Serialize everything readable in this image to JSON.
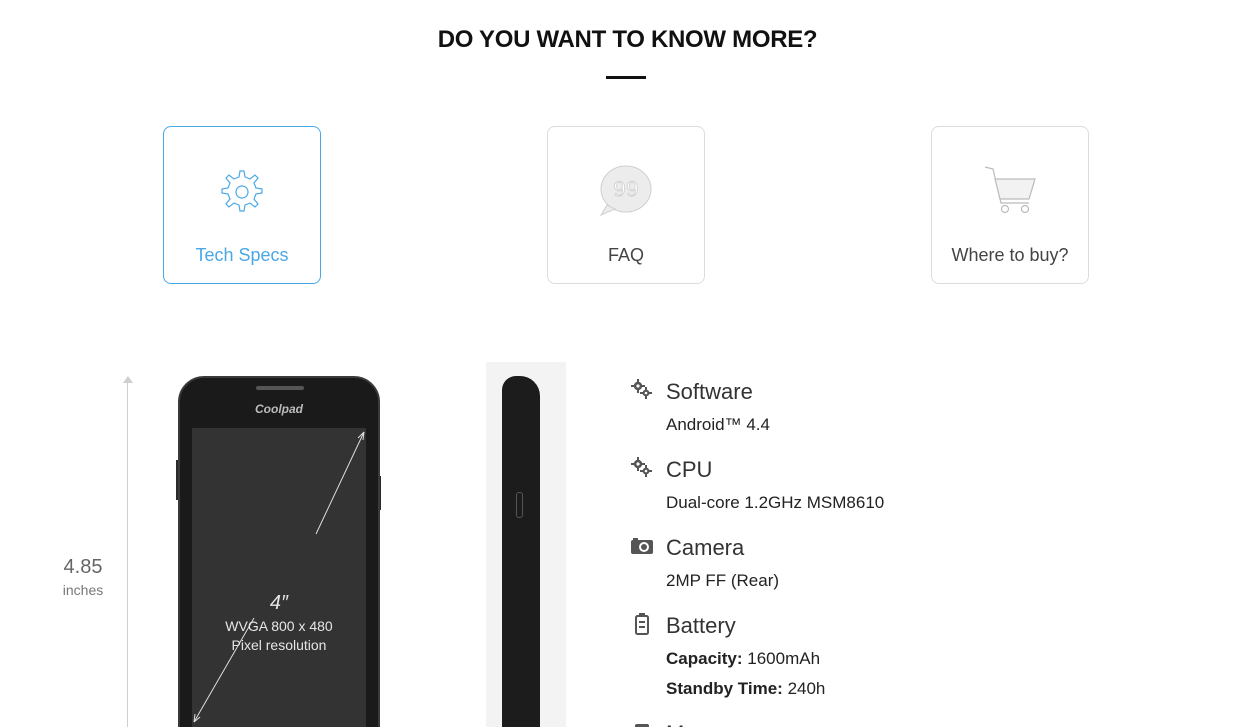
{
  "heading": "DO YOU WANT TO KNOW MORE?",
  "cards": [
    {
      "label": "Tech Specs",
      "icon": "gear-icon",
      "active": true
    },
    {
      "label": "FAQ",
      "icon": "speech-bubble-icon",
      "active": false
    },
    {
      "label": "Where to buy?",
      "icon": "shopping-cart-icon",
      "active": false
    }
  ],
  "colors": {
    "accent": "#4aa8e6",
    "heading": "#111111"
  },
  "phone": {
    "height_value": "4.85",
    "height_unit": "inches",
    "brand": "Coolpad",
    "screen_size": "4″",
    "screen_resolution": "WVGA 800 x 480",
    "screen_caption": "Pixel resolution"
  },
  "specs": {
    "software": {
      "title": "Software",
      "value": "Android™ 4.4",
      "icon": "gears-icon"
    },
    "cpu": {
      "title": "CPU",
      "value": "Dual-core 1.2GHz MSM8610",
      "icon": "gears-icon"
    },
    "camera": {
      "title": "Camera",
      "value": "2MP FF (Rear)",
      "icon": "camera-icon"
    },
    "battery": {
      "title": "Battery",
      "icon": "battery-icon",
      "capacity_label": "Capacity:",
      "capacity_value": "1600mAh",
      "standby_label": "Standby Time:",
      "standby_value": "240h"
    },
    "next_title": "M"
  }
}
